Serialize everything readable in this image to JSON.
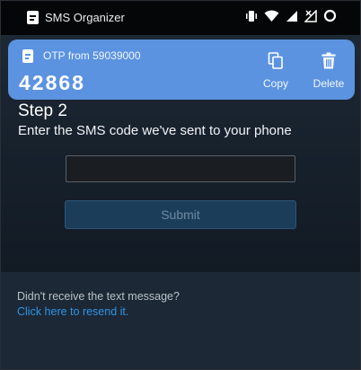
{
  "status_bar": {
    "app_name": "SMS Organizer"
  },
  "notification": {
    "title": "OTP from 59039000",
    "code": "42868",
    "copy_label": "Copy",
    "delete_label": "Delete"
  },
  "main": {
    "step_title": "Step 2",
    "step_subtitle": "Enter the SMS code we've sent to your phone",
    "code_input": {
      "value": "",
      "placeholder": ""
    },
    "submit_label": "Submit"
  },
  "resend": {
    "text": "Didn't receive the text message?",
    "link_label": "Click here to resend it."
  },
  "colors": {
    "notification_bg": "#5b93e0",
    "link": "#2e94e6",
    "submit_bg": "#1c3d5a"
  }
}
